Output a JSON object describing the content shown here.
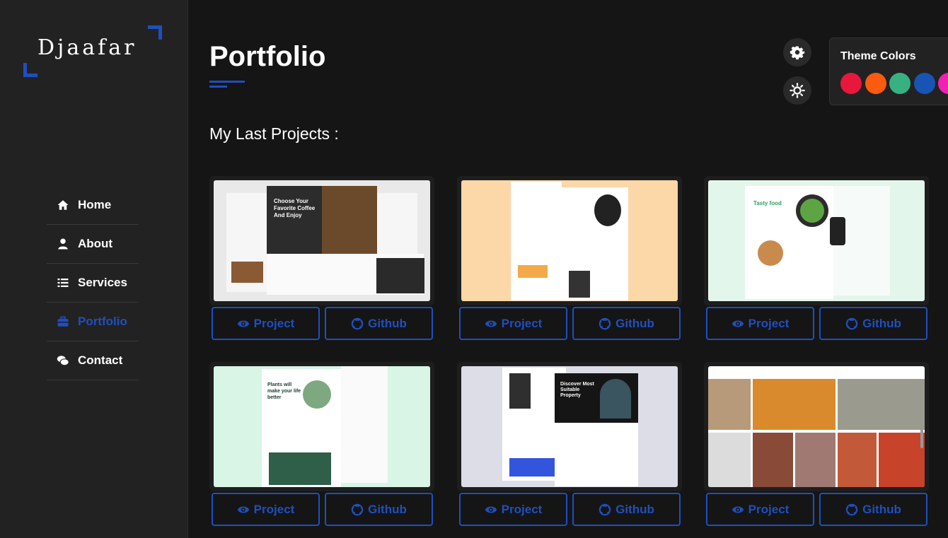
{
  "brand": {
    "logo_text": "Djaafar"
  },
  "nav": {
    "items": [
      {
        "label": "Home",
        "icon": "home-icon"
      },
      {
        "label": "About",
        "icon": "user-icon"
      },
      {
        "label": "Services",
        "icon": "list-icon"
      },
      {
        "label": "Portfolio",
        "icon": "briefcase-icon",
        "active": true
      },
      {
        "label": "Contact",
        "icon": "comments-icon"
      }
    ]
  },
  "header": {
    "title": "Portfolio",
    "subtitle": "My Last Projects :"
  },
  "controls": {
    "settings_icon": "gear-icon",
    "theme_toggle_icon": "sun-icon"
  },
  "theme_panel": {
    "title": "Theme Colors",
    "colors": [
      "#e8173b",
      "#fa5b0f",
      "#37b182",
      "#1854b4",
      "#f021b2"
    ]
  },
  "accent_color": "#1f4fbf",
  "projects": [
    {
      "thumb": "Coffee shop website",
      "project_label": "Project",
      "github_label": "Github"
    },
    {
      "thumb": "Watch store website",
      "project_label": "Project",
      "github_label": "Github"
    },
    {
      "thumb": "Tasty food website",
      "project_label": "Project",
      "github_label": "Github"
    },
    {
      "thumb": "Plants shop website",
      "project_label": "Project",
      "github_label": "Github"
    },
    {
      "thumb": "Real estate property website",
      "project_label": "Project",
      "github_label": "Github"
    },
    {
      "thumb": "Photo gallery website",
      "project_label": "Project",
      "github_label": "Github"
    }
  ],
  "thumb_text": {
    "coffee_heading": "Choose Your Favorite Coffee And Enjoy",
    "food_heading": "Tasty food",
    "plants_heading": "Plants will make your life better",
    "property_heading": "Discover Most Suitable Property"
  }
}
